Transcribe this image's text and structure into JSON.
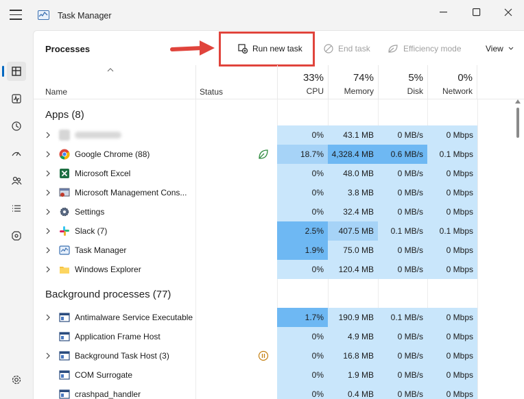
{
  "window": {
    "title": "Task Manager"
  },
  "toolbar": {
    "page_title": "Processes",
    "run_new_task": "Run new task",
    "end_task": "End task",
    "efficiency_mode": "Efficiency mode",
    "view": "View"
  },
  "columns": {
    "name": "Name",
    "status": "Status",
    "cpu": {
      "pct": "33%",
      "label": "CPU"
    },
    "memory": {
      "pct": "74%",
      "label": "Memory"
    },
    "disk": {
      "pct": "5%",
      "label": "Disk"
    },
    "network": {
      "pct": "0%",
      "label": "Network"
    }
  },
  "groups": {
    "apps": "Apps (8)",
    "background": "Background processes (77)"
  },
  "apps": [
    {
      "name": "",
      "cpu": "0%",
      "mem": "43.1 MB",
      "disk": "0 MB/s",
      "net": "0 Mbps",
      "icon": "blurred-app-icon"
    },
    {
      "name": "Google Chrome (88)",
      "cpu": "18.7%",
      "mem": "4,328.4 MB",
      "disk": "0.6 MB/s",
      "net": "0.1 Mbps",
      "icon": "chrome-icon"
    },
    {
      "name": "Microsoft Excel",
      "cpu": "0%",
      "mem": "48.0 MB",
      "disk": "0 MB/s",
      "net": "0 Mbps",
      "icon": "excel-icon"
    },
    {
      "name": "Microsoft Management Cons...",
      "cpu": "0%",
      "mem": "3.8 MB",
      "disk": "0 MB/s",
      "net": "0 Mbps",
      "icon": "mmc-icon"
    },
    {
      "name": "Settings",
      "cpu": "0%",
      "mem": "32.4 MB",
      "disk": "0 MB/s",
      "net": "0 Mbps",
      "icon": "settings-icon"
    },
    {
      "name": "Slack (7)",
      "cpu": "2.5%",
      "mem": "407.5 MB",
      "disk": "0.1 MB/s",
      "net": "0.1 Mbps",
      "icon": "slack-icon"
    },
    {
      "name": "Task Manager",
      "cpu": "1.9%",
      "mem": "75.0 MB",
      "disk": "0 MB/s",
      "net": "0 Mbps",
      "icon": "task-manager-icon"
    },
    {
      "name": "Windows Explorer",
      "cpu": "0%",
      "mem": "120.4 MB",
      "disk": "0 MB/s",
      "net": "0 Mbps",
      "icon": "folder-icon"
    }
  ],
  "background": [
    {
      "name": "Antimalware Service Executable",
      "cpu": "1.7%",
      "mem": "190.9 MB",
      "disk": "0.1 MB/s",
      "net": "0 Mbps",
      "icon": "service-icon"
    },
    {
      "name": "Application Frame Host",
      "cpu": "0%",
      "mem": "4.9 MB",
      "disk": "0 MB/s",
      "net": "0 Mbps",
      "icon": "service-icon"
    },
    {
      "name": "Background Task Host (3)",
      "cpu": "0%",
      "mem": "16.8 MB",
      "disk": "0 MB/s",
      "net": "0 Mbps",
      "icon": "service-icon"
    },
    {
      "name": "COM Surrogate",
      "cpu": "0%",
      "mem": "1.9 MB",
      "disk": "0 MB/s",
      "net": "0 Mbps",
      "icon": "service-icon"
    },
    {
      "name": "crashpad_handler",
      "cpu": "0%",
      "mem": "0.4 MB",
      "disk": "0 MB/s",
      "net": "0 Mbps",
      "icon": "service-icon"
    }
  ],
  "colors": {
    "accent": "#0067c0",
    "heat_low": "#c9e6fb",
    "heat_mid": "#a6d3f7",
    "heat_high": "#6eb8f3",
    "callout": "#e0443c"
  }
}
